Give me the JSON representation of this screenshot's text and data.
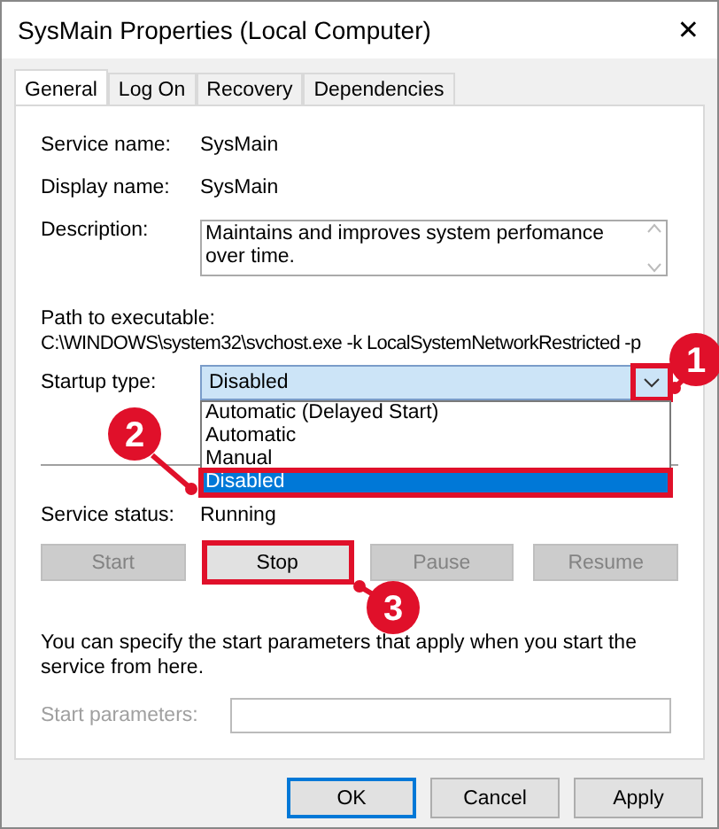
{
  "window": {
    "title": "SysMain Properties (Local Computer)",
    "close": "✕"
  },
  "tabs": [
    {
      "label": "General",
      "selected": true
    },
    {
      "label": "Log On",
      "selected": false
    },
    {
      "label": "Recovery",
      "selected": false
    },
    {
      "label": "Dependencies",
      "selected": false
    }
  ],
  "fields": [
    {
      "label": "Service name:",
      "value": "SysMain"
    },
    {
      "label": "Display name:",
      "value": "SysMain"
    }
  ],
  "description": {
    "label": "Description:",
    "value": "Maintains and improves system perfomance over time."
  },
  "path": {
    "label": "Path to executable:",
    "value": "C:\\WINDOWS\\system32\\svchost.exe -k LocalSystemNetworkRestricted -p"
  },
  "startup_type": {
    "label": "Startup type:",
    "value": "Disabled",
    "expanded": true,
    "arrow_highlighted": true,
    "options": [
      {
        "label": "Automatic (Delayed Start)",
        "selected": false,
        "highlighted": false
      },
      {
        "label": "Automatic",
        "selected": false,
        "highlighted": false
      },
      {
        "label": "Manual",
        "selected": false,
        "highlighted": false
      },
      {
        "label": "Disabled",
        "selected": true,
        "highlighted": true
      }
    ]
  },
  "status": {
    "label": "Service status:",
    "value": "Running"
  },
  "service_buttons": [
    {
      "label": "Start",
      "disabled": true,
      "highlighted": false
    },
    {
      "label": "Stop",
      "disabled": false,
      "highlighted": true
    },
    {
      "label": "Pause",
      "disabled": true,
      "highlighted": false
    },
    {
      "label": "Resume",
      "disabled": true,
      "highlighted": false
    }
  ],
  "help_text": "You can specify the start parameters that apply when you start the service from here.",
  "start_parameters": {
    "label": "Start parameters:",
    "disabled": true
  },
  "dialog_buttons": [
    {
      "label": "OK",
      "default": true
    },
    {
      "label": "Cancel",
      "default": false
    },
    {
      "label": "Apply",
      "default": false
    }
  ],
  "annotations": [
    {
      "number": "1"
    },
    {
      "number": "2"
    },
    {
      "number": "3"
    }
  ]
}
